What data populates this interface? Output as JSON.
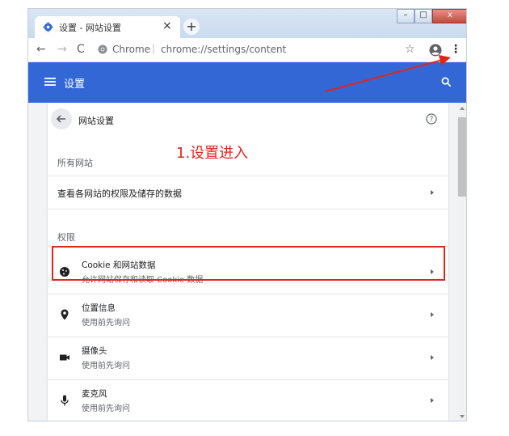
{
  "colors": {
    "accent": "#3367d6",
    "annotation": "#e0261b"
  },
  "browser": {
    "tab_title": "设置 - 网站设置",
    "tab_close": "×",
    "new_tab": "+",
    "window_controls": {
      "minimize": "–",
      "maximize": "□",
      "close": "x"
    },
    "omnibox_site": "Chrome",
    "omnibox_separator": "|",
    "omnibox_url": "chrome://settings/content",
    "icons": [
      "settings-gear-favicon",
      "back-arrow",
      "forward-arrow",
      "reload",
      "chrome-logo",
      "star",
      "account",
      "kebab-menu"
    ]
  },
  "header": {
    "title": "设置",
    "icons": [
      "menu-icon",
      "search-icon"
    ]
  },
  "page": {
    "title": "网站设置",
    "all_sites_label": "所有网站",
    "all_sites_link": "查看各网站的权限及储存的数据",
    "permissions_label": "权限"
  },
  "permissions": [
    {
      "title": "Cookie 和网站数据",
      "subtitle": "允许网站保存和读取 Cookie 数据",
      "icon": "cookie-icon"
    },
    {
      "title": "位置信息",
      "subtitle": "使用前先询问",
      "icon": "location-icon"
    },
    {
      "title": "摄像头",
      "subtitle": "使用前先询问",
      "icon": "camera-icon"
    },
    {
      "title": "麦克风",
      "subtitle": "使用前先询问",
      "icon": "mic-icon"
    }
  ],
  "annotation": {
    "text": "1.设置进入"
  }
}
